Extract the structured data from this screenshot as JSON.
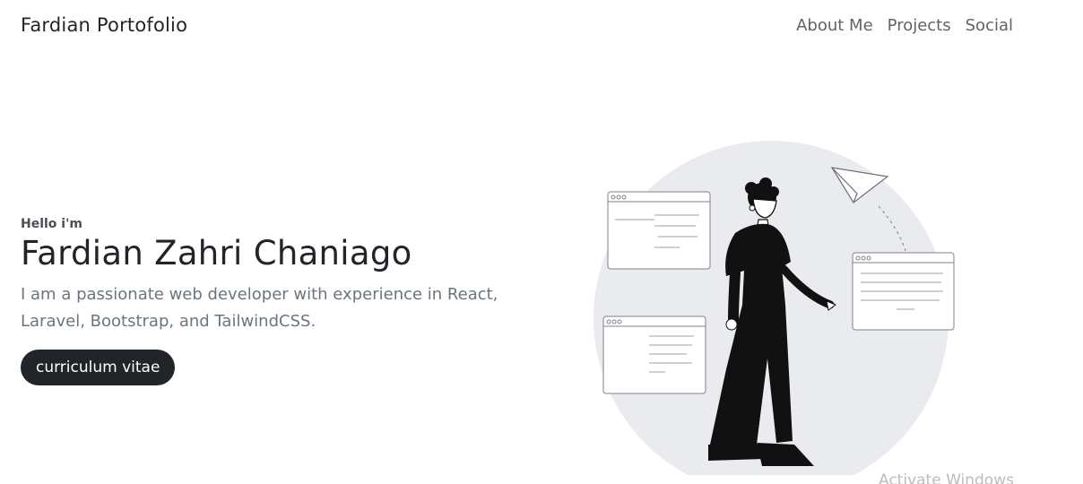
{
  "navbar": {
    "brand": "Fardian Portofolio",
    "links": [
      {
        "label": "About Me"
      },
      {
        "label": "Projects"
      },
      {
        "label": "Social"
      }
    ]
  },
  "hero": {
    "greeting": "Hello i'm",
    "name": "Fardian Zahri Chaniago",
    "description": "I am a passionate web developer with experience in React, Laravel, Bootstrap, and TailwindCSS.",
    "cv_button": "curriculum vitae"
  },
  "illustration": {
    "icons": [
      "paper-plane-icon",
      "browser-window-icon"
    ],
    "colors": {
      "circle": "#e9ebee",
      "ink": "#111111"
    }
  },
  "watermark": {
    "text": "Activate Windows"
  }
}
